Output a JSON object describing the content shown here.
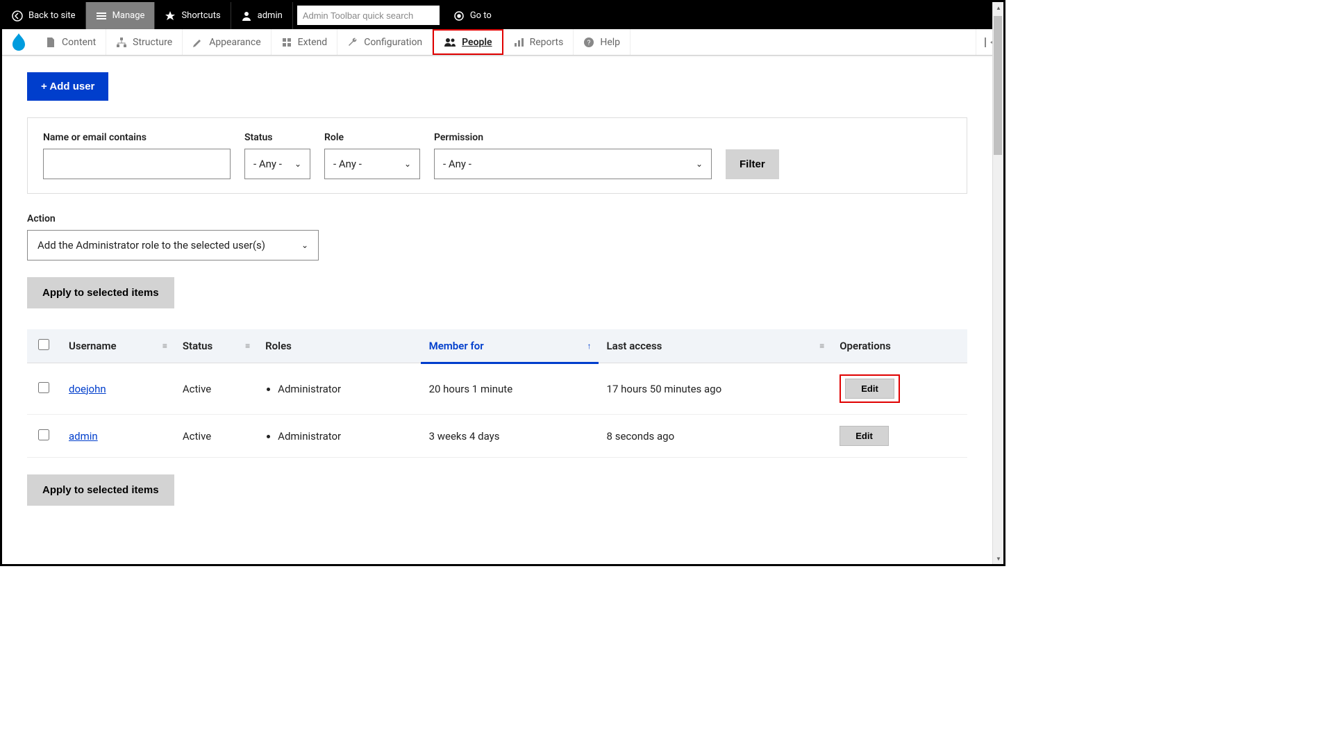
{
  "toolbar": {
    "back": "Back to site",
    "manage": "Manage",
    "shortcuts": "Shortcuts",
    "admin": "admin",
    "search_placeholder": "Admin Toolbar quick search",
    "goto": "Go to"
  },
  "menu": {
    "content": "Content",
    "structure": "Structure",
    "appearance": "Appearance",
    "extend": "Extend",
    "configuration": "Configuration",
    "people": "People",
    "reports": "Reports",
    "help": "Help"
  },
  "page": {
    "add_user": "+ Add user"
  },
  "filters": {
    "name_label": "Name or email contains",
    "name_value": "",
    "status_label": "Status",
    "status_value": "- Any -",
    "role_label": "Role",
    "role_value": "- Any -",
    "perm_label": "Permission",
    "perm_value": "- Any -",
    "filter_btn": "Filter"
  },
  "action": {
    "label": "Action",
    "value": "Add the Administrator role to the selected user(s)",
    "apply": "Apply to selected items"
  },
  "table": {
    "headers": {
      "username": "Username",
      "status": "Status",
      "roles": "Roles",
      "member_for": "Member for",
      "last_access": "Last access",
      "operations": "Operations"
    },
    "rows": [
      {
        "username": "doejohn",
        "status": "Active",
        "roles": "Administrator",
        "member_for": "20 hours 1 minute",
        "last_access": "17 hours 50 minutes ago",
        "edit": "Edit",
        "highlighted": true
      },
      {
        "username": "admin",
        "status": "Active",
        "roles": "Administrator",
        "member_for": "3 weeks 4 days",
        "last_access": "8 seconds ago",
        "edit": "Edit",
        "highlighted": false
      }
    ]
  }
}
